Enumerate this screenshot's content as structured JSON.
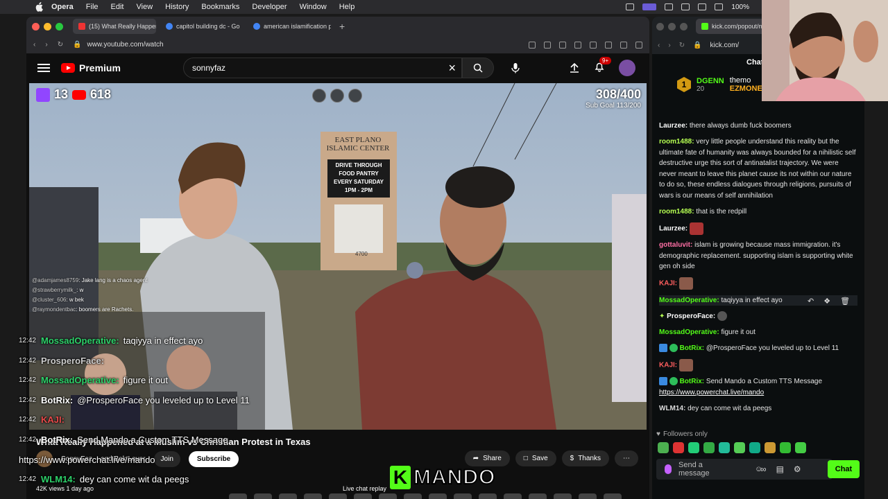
{
  "menubar": {
    "items": [
      "Opera",
      "File",
      "Edit",
      "View",
      "History",
      "Bookmarks",
      "Developer",
      "Window",
      "Help"
    ],
    "battery": "100%"
  },
  "browser_left": {
    "tabs": [
      {
        "label": "(15) What Really Happen",
        "color": "#e33"
      },
      {
        "label": "capitol building dc - Go",
        "color": "#4285f4"
      },
      {
        "label": "american islamification p",
        "color": "#4285f4"
      }
    ],
    "url": "www.youtube.com/watch"
  },
  "youtube": {
    "logo": "Premium",
    "search_value": "sonnyfaz",
    "notif_count": "9+",
    "video_title": "What Really Happened at a Muslim vs Christian Protest in Texas",
    "channel": "SonnyFaz",
    "join_label": "Join",
    "subscribe_label": "Subscribe",
    "share_label": "Share",
    "save_label": "Save",
    "thanks_label": "Thanks",
    "views": "42K views  1 day ago",
    "live_replay": "Live chat replay"
  },
  "video_overlay": {
    "twitch_count": "13",
    "youtube_count": "618",
    "goal_value": "308/400",
    "goal_sub": "Sub Goal 113/200",
    "sign_lines": [
      "EAST PLANO",
      "ISLAMIC CENTER"
    ],
    "food_lines": [
      "DRIVE THROUGH",
      "FOOD PANTRY",
      "EVERY SATURDAY",
      "1PM - 2PM"
    ],
    "address": "4700",
    "mini_chat": [
      {
        "user": "@adamjames8759",
        "text": ": Jake lang is a chaos agent"
      },
      {
        "user": "@strawberrymilk_",
        "text": ": w"
      },
      {
        "user": "@cluster_606",
        "text": ": w bek"
      },
      {
        "user": "@raymondentbac",
        "text": ": boomers are Rachets."
      }
    ],
    "big_chat": [
      {
        "ts": "12:42",
        "user": "MossadOperative:",
        "text": "taqiyya in effect ayo",
        "kind": "green"
      },
      {
        "ts": "12:42",
        "user": "ProsperoFace:",
        "text": "",
        "kind": "pros"
      },
      {
        "ts": "12:42",
        "user": "MossadOperative:",
        "text": "figure it out",
        "kind": "green"
      },
      {
        "ts": "12:42",
        "user": "BotRix:",
        "text": "@ProsperoFace you leveled up to Level 11",
        "kind": "bot"
      },
      {
        "ts": "12:42",
        "user": "KAJI:",
        "text": "",
        "kind": "kaji"
      },
      {
        "ts": "12:42",
        "user": "BotRix:",
        "text": "Send Mando a Custom TTS Message",
        "kind": "bot"
      },
      {
        "ts": "",
        "user": "",
        "text": "https://www.powerchat.live/mando",
        "kind": "link"
      },
      {
        "ts": "12:42",
        "user": "WLM14:",
        "text": "dey can come wit da peegs",
        "kind": "bot"
      }
    ],
    "with_label": "SonnyFaz",
    "and_label": "and Bek Lover",
    "mando": "MANDO",
    "kick_letter": "K"
  },
  "browser_right": {
    "tab_label": "kick.com/popout/mand",
    "url": "kick.com/",
    "chat_title": "Chat",
    "pinned": {
      "rank": "1",
      "user": "DGENN",
      "count": "20",
      "user2": "themo",
      "user3": "EZMONE"
    }
  },
  "kick_chat": [
    {
      "user": "Laurzee:",
      "text": "there always dumb fuck boomers",
      "color": "u-white"
    },
    {
      "user": "room1488:",
      "text": "very little people understand this reality but the ultimate fate of humanity was always bounded for a nihilistic self destructive urge this sort of antinatalist trajectory. We were never meant to leave this planet cause its not within our nature to do so, these endless dialogues through religions, pursuits of wars is our means of self annihilation",
      "color": "u-lime"
    },
    {
      "user": "room1488:",
      "text": "that is the redpill",
      "color": "u-lime"
    },
    {
      "user": "Laurzee:",
      "text": "",
      "color": "u-white",
      "emote": true
    },
    {
      "user": "gottaluvit:",
      "text": "islam is growing because mass immigration. it's demographic replacement. supporting islam is supporting white gen oh side",
      "color": "u-pink"
    },
    {
      "user": "KAJI:",
      "text": "",
      "color": "u-red",
      "emote": true
    },
    {
      "user": "MossadOperative:",
      "text": "taqiyya in effect ayo",
      "color": "u-green"
    },
    {
      "user": "ProsperoFace:",
      "text": "",
      "color": "u-white",
      "emote": true
    },
    {
      "user": "MossadOperative:",
      "text": "figure it out",
      "color": "u-green"
    },
    {
      "user": "BotRix:",
      "text": "@ProsperoFace you leveled up to Level 11",
      "color": "u-green",
      "bot": true
    },
    {
      "user": "KAJI:",
      "text": "",
      "color": "u-red",
      "emote": true
    },
    {
      "user": "BotRix:",
      "text": "Send Mando a Custom TTS Message",
      "color": "u-green",
      "bot": true,
      "link": "https://www.powerchat.live/mando"
    },
    {
      "user": "WLM14:",
      "text": "dey can come wit da peegs",
      "color": "u-white"
    }
  ],
  "kick_footer": {
    "followers_only": "Followers only",
    "input_placeholder": "Send a message",
    "chat_button": "Chat"
  }
}
